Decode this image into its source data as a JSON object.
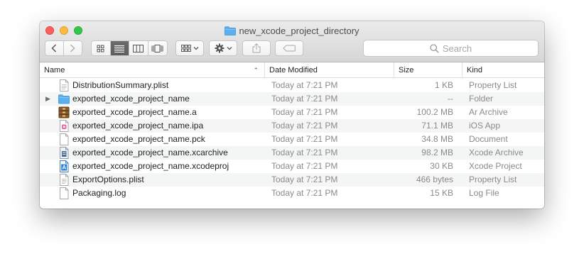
{
  "window": {
    "title": "new_xcode_project_directory",
    "folder_color": "#5ab0ef"
  },
  "toolbar": {
    "back_icon": "chevron-left-icon",
    "forward_icon": "chevron-right-icon",
    "view_modes": [
      "icon-view",
      "list-view",
      "column-view",
      "cover-flow-view"
    ],
    "active_view": "list-view",
    "search_placeholder": "Search"
  },
  "columns": {
    "name": "Name",
    "date": "Date Modified",
    "size": "Size",
    "kind": "Kind"
  },
  "files": [
    {
      "name": "DistributionSummary.plist",
      "date": "Today at 7:21 PM",
      "size": "1 KB",
      "kind": "Property List",
      "icon": "plist-document-icon",
      "folder": false
    },
    {
      "name": "exported_xcode_project_name",
      "date": "Today at 7:21 PM",
      "size": "--",
      "kind": "Folder",
      "icon": "folder-icon",
      "folder": true
    },
    {
      "name": "exported_xcode_project_name.a",
      "date": "Today at 7:21 PM",
      "size": "100.2 MB",
      "kind": "Ar Archive",
      "icon": "archive-icon",
      "folder": false
    },
    {
      "name": "exported_xcode_project_name.ipa",
      "date": "Today at 7:21 PM",
      "size": "71.1 MB",
      "kind": "iOS App",
      "icon": "ios-app-icon",
      "folder": false
    },
    {
      "name": "exported_xcode_project_name.pck",
      "date": "Today at 7:21 PM",
      "size": "34.8 MB",
      "kind": "Document",
      "icon": "document-icon",
      "folder": false
    },
    {
      "name": "exported_xcode_project_name.xcarchive",
      "date": "Today at 7:21 PM",
      "size": "98.2 MB",
      "kind": "Xcode Archive",
      "icon": "xcode-archive-icon",
      "folder": false
    },
    {
      "name": "exported_xcode_project_name.xcodeproj",
      "date": "Today at 7:21 PM",
      "size": "30 KB",
      "kind": "Xcode Project",
      "icon": "xcode-project-icon",
      "folder": false
    },
    {
      "name": "ExportOptions.plist",
      "date": "Today at 7:21 PM",
      "size": "466 bytes",
      "kind": "Property List",
      "icon": "plist-document-icon",
      "folder": false
    },
    {
      "name": "Packaging.log",
      "date": "Today at 7:21 PM",
      "size": "15 KB",
      "kind": "Log File",
      "icon": "log-document-icon",
      "folder": false
    }
  ]
}
